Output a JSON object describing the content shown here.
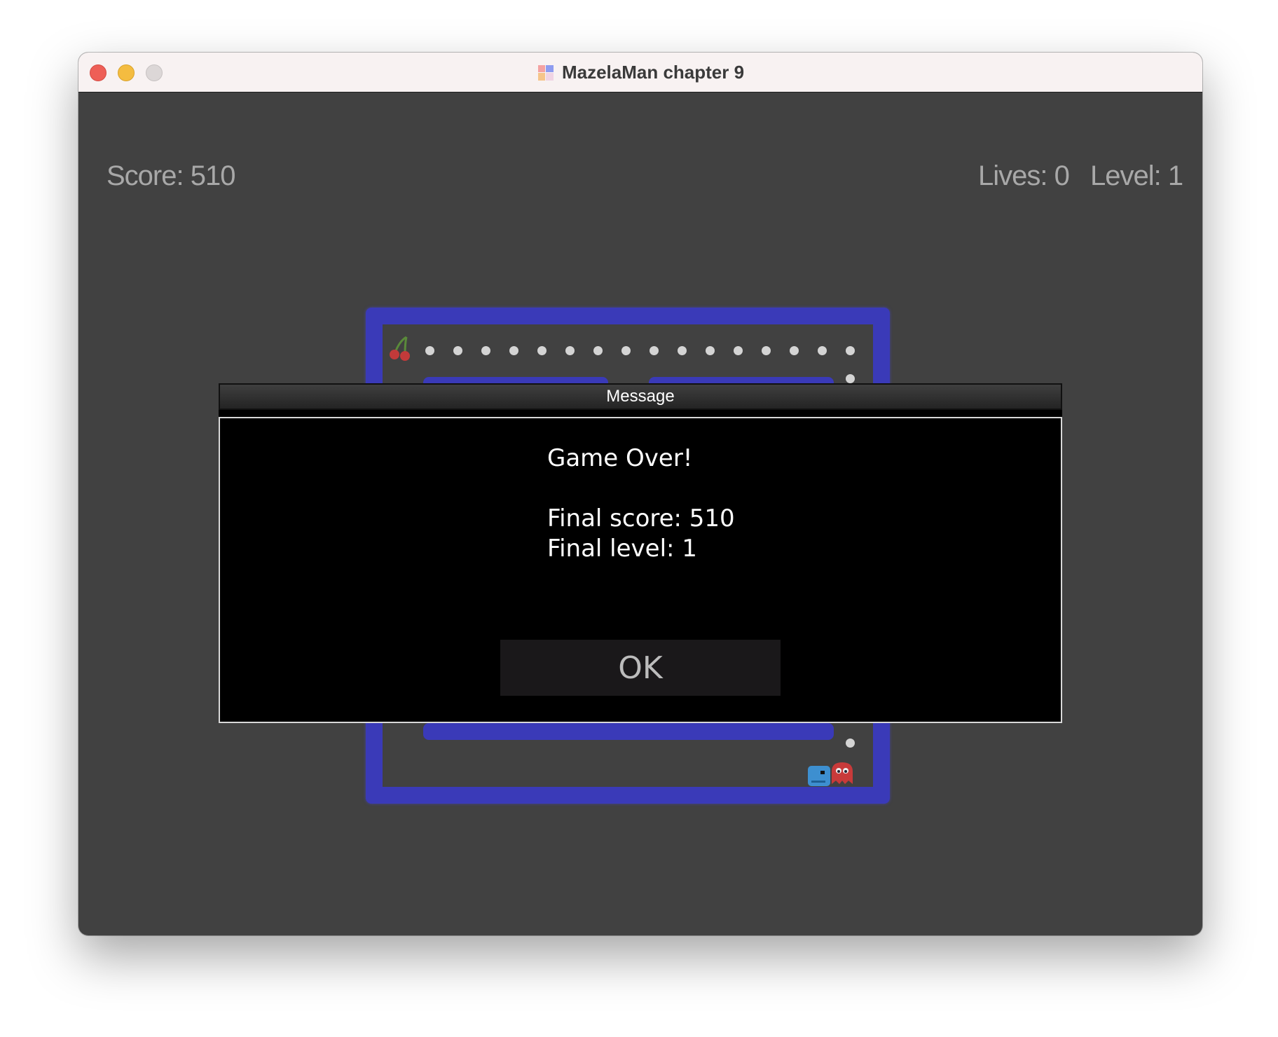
{
  "window": {
    "title": "MazelaMan chapter 9"
  },
  "hud": {
    "score": "Score: 510",
    "lives": "Lives: 0",
    "level": "Level: 1"
  },
  "dialog": {
    "title": "Message",
    "line1": "Game Over!",
    "line2": "Final score: 510",
    "line3": "Final level: 1",
    "ok_label": "OK"
  },
  "colors": {
    "background": "#414141",
    "maze_wall": "#3a3ab8",
    "pellet": "#d4d4d4",
    "hud_text": "#a8a8a8"
  },
  "icons": [
    "app-puzzle-icon",
    "cherry-icon",
    "player-icon",
    "ghost-icon"
  ]
}
